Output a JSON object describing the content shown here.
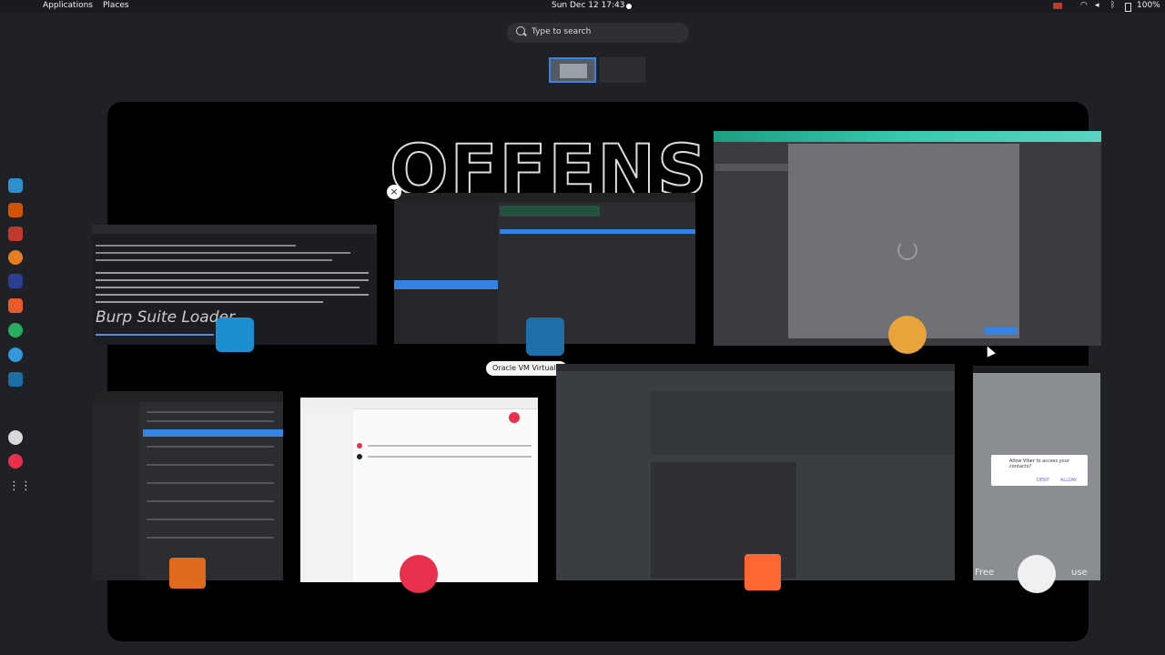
{
  "topbar": {
    "applications": "Applications",
    "places": "Places",
    "clock": "Sun Dec 12 17:43",
    "battery": "100%"
  },
  "search": {
    "placeholder": "Type to search"
  },
  "overview": {
    "hovered_window_label": "Oracle VM VirtualB"
  },
  "phone_window": {
    "dialog_text": "Allow Viber to access your contacts?",
    "deny": "DENY",
    "allow": "ALLOW",
    "bottom_text_left": "Free",
    "bottom_text_right": "use"
  },
  "icons": {
    "dock": [
      "terminal-icon",
      "files-icon",
      "editor-icon",
      "firefox-icon",
      "mendeley-icon",
      "burp-icon",
      "git-icon",
      "chrome-icon",
      "virtualbox-icon",
      "genymotion-icon",
      "genymotion2-icon",
      "show-apps-icon"
    ]
  },
  "colors": {
    "accent": "#3584e4",
    "genymotion": "#e8304e",
    "burp": "#ff6633"
  }
}
